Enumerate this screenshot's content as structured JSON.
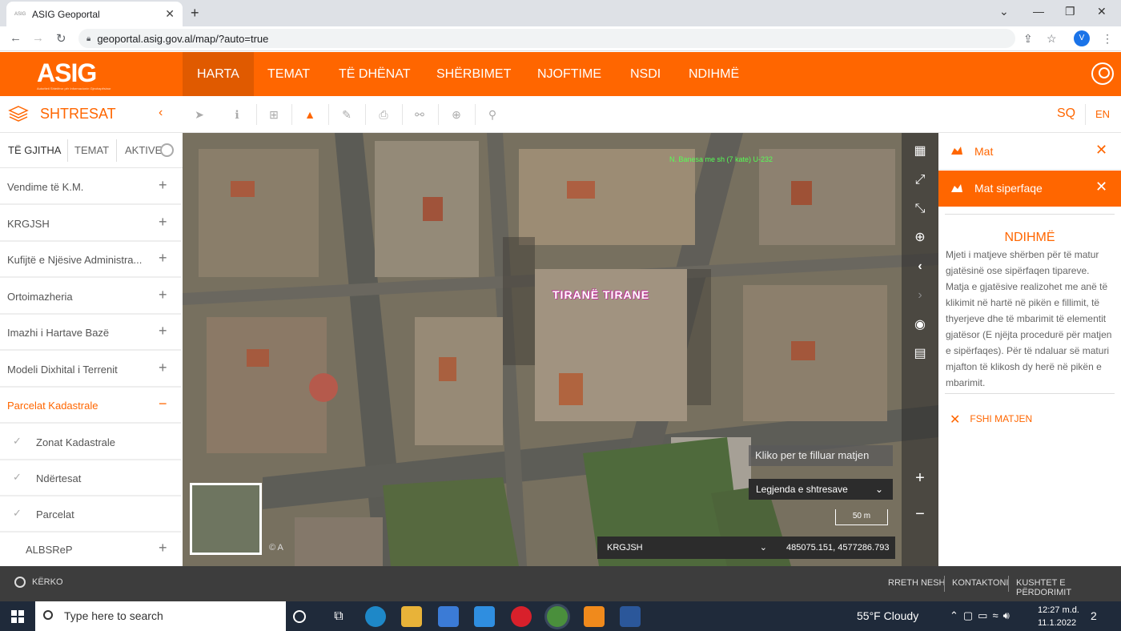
{
  "browser": {
    "tab_title": "ASIG Geoportal",
    "favicon_text": "ASIG",
    "url": "geoportal.asig.gov.al/map/?auto=true",
    "profile_initial": "V"
  },
  "header": {
    "logo": "ASIG",
    "logo_tagline": "Autoriteti Shtetëror për Informacionin Gjeohapësinor",
    "nav": [
      "HARTA",
      "TEMAT",
      "TË DHËNAT",
      "SHËRBIMET",
      "NJOFTIME",
      "NSDI",
      "NDIHMË"
    ],
    "active_nav": "HARTA"
  },
  "toolbar": {
    "layers_title": "SHTRESAT",
    "lang_sq": "SQ",
    "lang_en": "EN"
  },
  "left_panel": {
    "tabs": [
      "TË GJITHA",
      "TEMAT",
      "AKTIVE"
    ],
    "layers": [
      {
        "label": "Vendime të K.M.",
        "toggle": "+"
      },
      {
        "label": "KRGJSH",
        "toggle": "+"
      },
      {
        "label": "Kufijtë e Njësive Administra...",
        "toggle": "+"
      },
      {
        "label": "Ortoimazheria",
        "toggle": "+"
      },
      {
        "label": "Imazhi i Hartave Bazë",
        "toggle": "+"
      },
      {
        "label": "Modeli Dixhital i Terrenit",
        "toggle": "+"
      },
      {
        "label": "Parcelat Kadastrale",
        "toggle": "−"
      }
    ],
    "sublayers": [
      "Zonat Kadastrale",
      "Ndërtesat",
      "Parcelat"
    ],
    "last_layer": {
      "label": "ALBSReP",
      "toggle": "+"
    }
  },
  "map": {
    "top_label": "N. Banesa me sh (7 kate) U-232",
    "city_label": "TIRANË TIRANE",
    "hint": "Kliko per te filluar matjen",
    "legend": "Legjenda e shtresave",
    "scale": "50 m",
    "crs": "KRGJSH",
    "coordinates": "485075.151, 4577286.793",
    "copyright": "© A"
  },
  "right_panel": {
    "mat_title": "Mat",
    "area_title": "Mat siperfaqe",
    "help_title": "NDIHMË",
    "help_text": "Mjeti i matjeve shërben për të matur gjatësinë ose sipërfaqen tipareve. Matja e gjatësive realizohet me anë të klikimit në hartë në pikën e fillimit, të thyerjeve dhe të mbarimit të elementit gjatësor (E njëjta procedurë për matjen e sipërfaqes). Për të ndaluar së maturi mjafton të klikosh dy herë në pikën e mbarimit.",
    "clear_label": "FSHI MATJEN"
  },
  "footer": {
    "search_label": "KËRKO",
    "links": [
      "RRETH NESH",
      "KONTAKTONI",
      "KUSHTET E PËRDORIMIT"
    ]
  },
  "taskbar": {
    "search_placeholder": "Type here to search",
    "weather": "55°F  Cloudy",
    "time": "12:27 m.d.",
    "date": "11.1.2022",
    "notifications": "2"
  },
  "colors": {
    "brand": "#ff6600",
    "footer": "#3d3d3d",
    "taskbar": "#1f2a3a"
  }
}
